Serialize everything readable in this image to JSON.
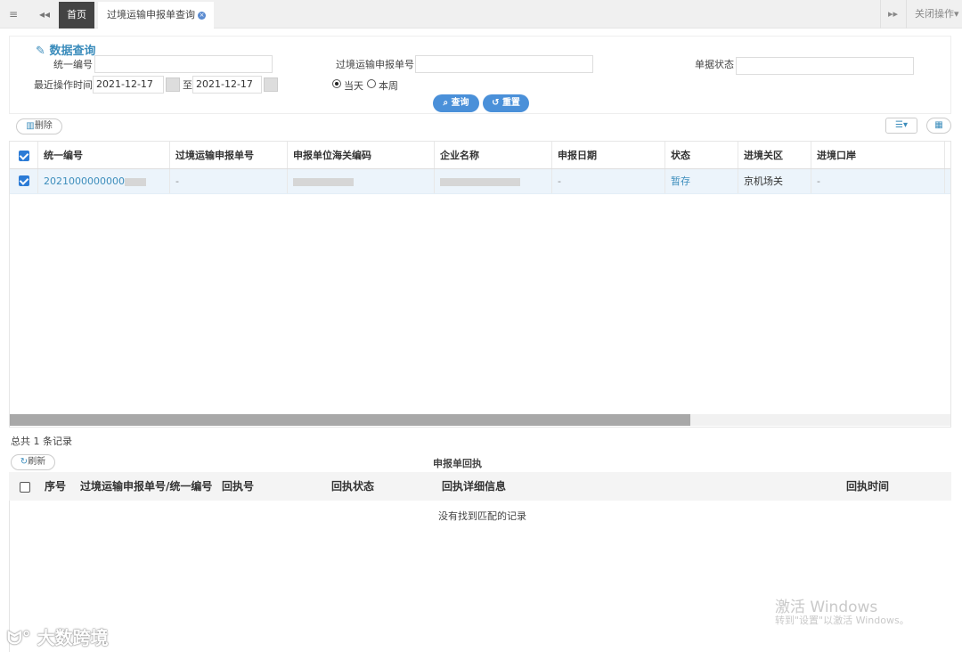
{
  "topbar": {
    "home_tab": "首页",
    "active_tab": "过境运输申报单查询",
    "close_ops": "关闭操作"
  },
  "query": {
    "title": "数据查询",
    "label_uid": "统一编号",
    "label_transport_no": "过境运输申报单号",
    "label_status": "单据状态",
    "label_time": "最近操作时间",
    "date_from": "2021-12-17",
    "date_sep": "至",
    "date_to": "2021-12-17",
    "radio_today": "当天",
    "radio_week": "本周",
    "search_btn": "查询",
    "reset_btn": "重置"
  },
  "toolbar": {
    "delete_btn": "删除"
  },
  "grid": {
    "columns": [
      "统一编号",
      "过境运输申报单号",
      "申报单位海关编码",
      "企业名称",
      "申报日期",
      "状态",
      "进境关区",
      "进境口岸"
    ],
    "rows": [
      {
        "uid": "2021000000000",
        "transport_no": "-",
        "customs_code": "",
        "company": "",
        "date": "-",
        "status": "暂存",
        "entry_area": "京机场关",
        "entry_port": "-"
      }
    ]
  },
  "total_text": "总共 1 条记录",
  "receipt": {
    "refresh_btn": "刷新",
    "title": "申报单回执",
    "columns": [
      "序号",
      "过境运输申报单号/统一编号",
      "回执号",
      "回执状态",
      "回执详细信息",
      "回执时间"
    ],
    "empty_text": "没有找到匹配的记录"
  },
  "watermark": {
    "line1": "激活 Windows",
    "line2": "转到\"设置\"以激活 Windows。"
  },
  "logo_text": "大数跨境",
  "colors": {
    "accent": "#3c8dbc",
    "button": "#4a90d9",
    "row_highlight": "#ecf4fb"
  }
}
